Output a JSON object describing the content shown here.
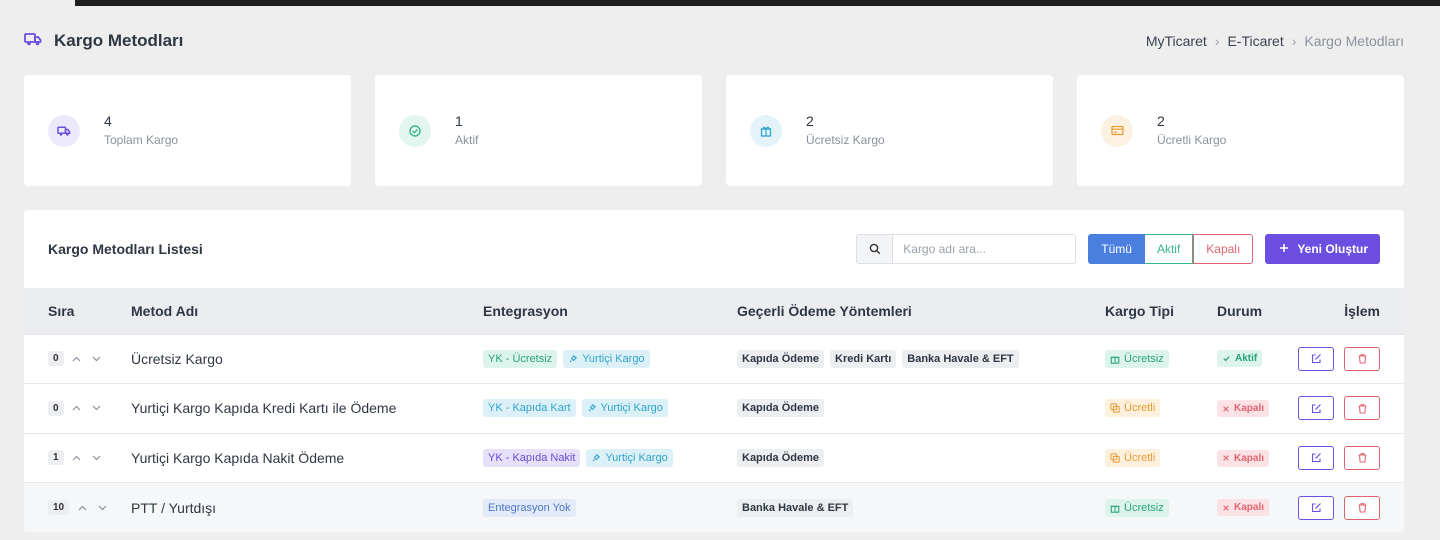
{
  "page": {
    "title": "Kargo Metodları",
    "icon": "truck-icon",
    "accent": "#6c4fe0"
  },
  "breadcrumb": [
    "MyTicaret",
    "E-Ticaret",
    "Kargo Metodları"
  ],
  "stats": [
    {
      "value": "4",
      "label": "Toplam Kargo",
      "icon": "truck-icon",
      "color": "#6c4fe0",
      "bg": "#ece9fb"
    },
    {
      "value": "1",
      "label": "Aktif",
      "icon": "check-circle-icon",
      "color": "#3bb58f",
      "bg": "#e2f6ef"
    },
    {
      "value": "2",
      "label": "Ücretsiz Kargo",
      "icon": "gift-icon",
      "color": "#31a4c9",
      "bg": "#e3f3f9"
    },
    {
      "value": "2",
      "label": "Ücretli Kargo",
      "icon": "card-icon",
      "color": "#e89a34",
      "bg": "#fdf2e2"
    }
  ],
  "list": {
    "title": "Kargo Metodları Listesi",
    "search_placeholder": "Kargo adı ara...",
    "filters": {
      "all": "Tümü",
      "active": "Aktif",
      "closed": "Kapalı"
    },
    "new_button": "Yeni Oluştur",
    "columns": {
      "order": "Sıra",
      "name": "Metod Adı",
      "integration": "Entegrasyon",
      "payments": "Geçerli Ödeme Yöntemleri",
      "type": "Kargo Tipi",
      "status": "Durum",
      "action": "İşlem"
    },
    "rows": [
      {
        "order": "0",
        "name": "Ücretsiz Kargo",
        "integration": [
          {
            "text": "YK - Ücretsiz",
            "style": "green"
          },
          {
            "text": "Yurtiçi Kargo",
            "style": "blue",
            "icon": "plug-icon"
          }
        ],
        "payments": [
          "Kapıda Ödeme",
          "Kredi Kartı",
          "Banka Havale & EFT"
        ],
        "type": {
          "text": "Ücretsiz",
          "style": "green",
          "icon": "gift-icon"
        },
        "status": {
          "text": "Aktif",
          "style": "green",
          "icon": "check-icon"
        }
      },
      {
        "order": "0",
        "name": "Yurtiçi Kargo Kapıda Kredi Kartı ile Ödeme",
        "integration": [
          {
            "text": "YK - Kapıda Kart",
            "style": "blue"
          },
          {
            "text": "Yurtiçi Kargo",
            "style": "blue",
            "icon": "plug-icon"
          }
        ],
        "payments": [
          "Kapıda Ödeme"
        ],
        "type": {
          "text": "Ücretli",
          "style": "orange",
          "icon": "coins-icon"
        },
        "status": {
          "text": "Kapalı",
          "style": "red",
          "icon": "x-icon"
        }
      },
      {
        "order": "1",
        "name": "Yurtiçi Kargo Kapıda Nakit Ödeme",
        "integration": [
          {
            "text": "YK - Kapıda Nakit",
            "style": "purple"
          },
          {
            "text": "Yurtiçi Kargo",
            "style": "blue",
            "icon": "plug-icon"
          }
        ],
        "payments": [
          "Kapıda Ödeme"
        ],
        "type": {
          "text": "Ücretli",
          "style": "orange",
          "icon": "coins-icon"
        },
        "status": {
          "text": "Kapalı",
          "style": "red",
          "icon": "x-icon"
        }
      },
      {
        "order": "10",
        "name": "PTT / Yurtdışı",
        "integration": [
          {
            "text": "Entegrasyon Yok",
            "style": "indigo"
          }
        ],
        "payments": [
          "Banka Havale & EFT"
        ],
        "type": {
          "text": "Ücretsiz",
          "style": "green",
          "icon": "gift-icon"
        },
        "status": {
          "text": "Kapalı",
          "style": "red",
          "icon": "x-icon"
        }
      }
    ]
  }
}
